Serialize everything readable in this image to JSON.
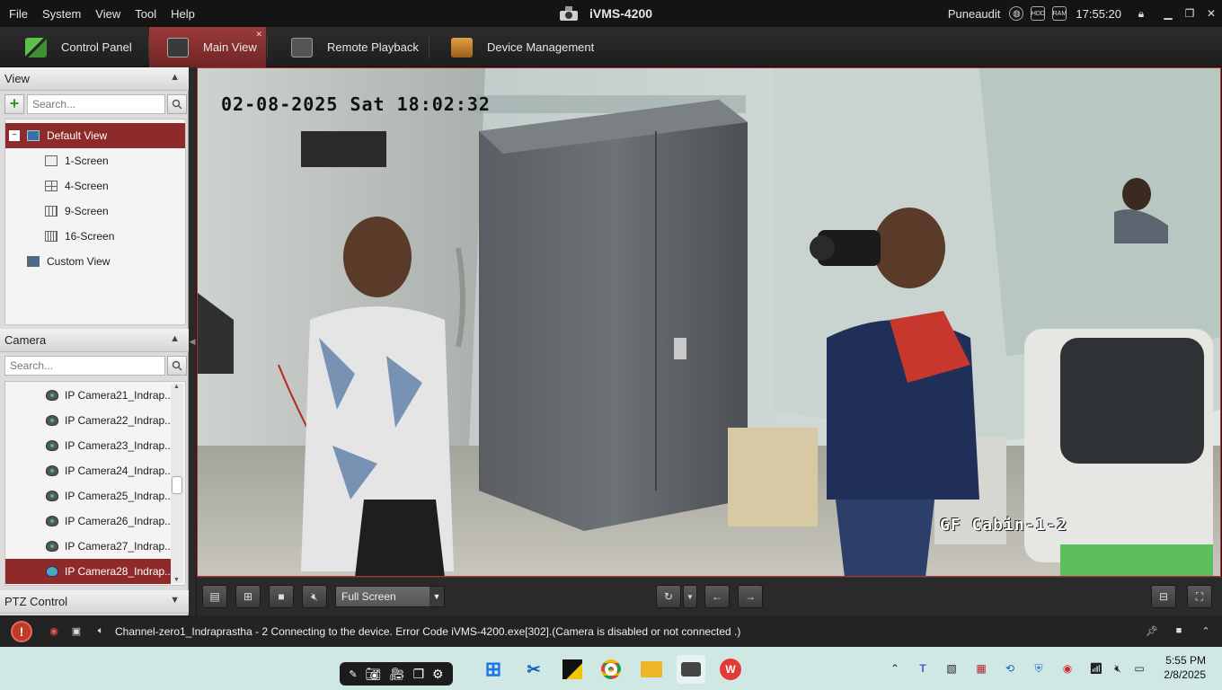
{
  "menu": [
    "File",
    "System",
    "View",
    "Tool",
    "Help"
  ],
  "app_title": "iVMS-4200",
  "titlebar": {
    "user": "Puneaudit",
    "time": "17:55:20"
  },
  "nav_tabs": [
    {
      "label": "Control Panel"
    },
    {
      "label": "Main View"
    },
    {
      "label": "Remote Playback"
    },
    {
      "label": "Device Management"
    }
  ],
  "view_panel": {
    "header": "View",
    "search_placeholder": "Search...",
    "items": [
      {
        "label": "Default View",
        "selected": true
      },
      {
        "label": "1-Screen"
      },
      {
        "label": "4-Screen"
      },
      {
        "label": "9-Screen"
      },
      {
        "label": "16-Screen"
      },
      {
        "label": "Custom View"
      }
    ]
  },
  "camera_panel": {
    "header": "Camera",
    "search_placeholder": "Search...",
    "items": [
      "IP Camera21_Indrap...",
      "IP Camera22_Indrap...",
      "IP Camera23_Indrap...",
      "IP Camera24_Indrap...",
      "IP Camera25_Indrap...",
      "IP Camera26_Indrap...",
      "IP Camera27_Indrap...",
      "IP Camera28_Indrap..."
    ],
    "selected_index": 7
  },
  "ptz_panel": {
    "header": "PTZ Control"
  },
  "video": {
    "timestamp": "02-08-2025 Sat 18:02:32",
    "camera_name": "GF Cabin-1-2"
  },
  "toolbar": {
    "screen_mode": "Full Screen"
  },
  "status": {
    "message": "Channel-zero1_Indraprastha - 2 Connecting to the device. Error Code iVMS-4200.exe[302].(Camera is disabled or not connected .)"
  },
  "taskbar": {
    "time": "5:55 PM",
    "date": "2/8/2025"
  },
  "colors": {
    "accent": "#8e2a2a",
    "tab_active": "#9c3a3a",
    "taskbar": "#cfe8e3"
  }
}
